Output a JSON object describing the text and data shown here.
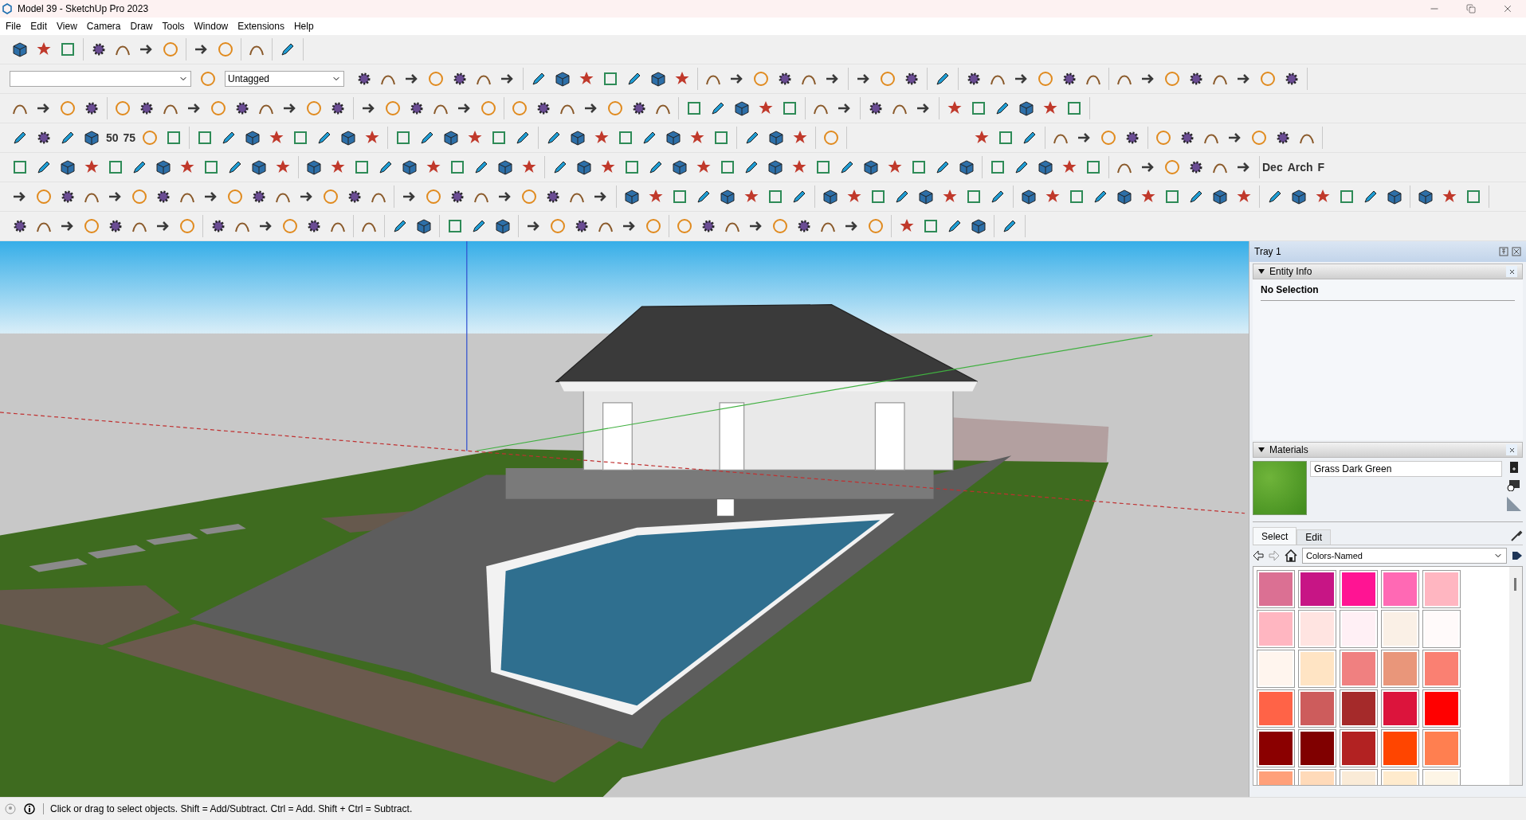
{
  "window": {
    "title": "Model 39 - SketchUp Pro 2023"
  },
  "menu": [
    "File",
    "Edit",
    "View",
    "Camera",
    "Draw",
    "Tools",
    "Window",
    "Extensions",
    "Help"
  ],
  "toolbar": {
    "tag_dropdown": "Untagged",
    "number_buttons": [
      "50",
      "75"
    ],
    "unit_buttons": [
      "Dec",
      "Arch",
      "F"
    ]
  },
  "tray": {
    "title": "Tray 1",
    "entity_info": {
      "title": "Entity Info",
      "expanded": true,
      "selection": "No Selection"
    },
    "materials": {
      "title": "Materials",
      "expanded": true,
      "material_name": "Grass Dark Green",
      "tabs": [
        {
          "label": "Select",
          "selected": true
        },
        {
          "label": "Edit",
          "selected": false
        }
      ],
      "collection": "Colors-Named",
      "swatches": [
        {
          "color": "#db7093"
        },
        {
          "color": "#c71585"
        },
        {
          "color": "#ff1493"
        },
        {
          "color": "#ff69b4"
        },
        {
          "color": "#ffb6c1"
        },
        {
          "color": "#ffb6c1"
        },
        {
          "color": "#ffe4e1"
        },
        {
          "color": "#fff0f5"
        },
        {
          "color": "#faf0e6"
        },
        {
          "color": "#fffafa"
        },
        {
          "color": "#fff5ee"
        },
        {
          "color": "#ffe4c4"
        },
        {
          "color": "#f08080"
        },
        {
          "color": "#e9967a"
        },
        {
          "color": "#fa8072"
        },
        {
          "color": "#ff6347"
        },
        {
          "color": "#cd5c5c"
        },
        {
          "color": "#a52a2a"
        },
        {
          "color": "#dc143c"
        },
        {
          "color": "#ff0000"
        },
        {
          "color": "#8b0000"
        },
        {
          "color": "#800000"
        },
        {
          "color": "#b22222"
        },
        {
          "color": "#ff4500"
        },
        {
          "color": "#ff7f50"
        },
        {
          "color": "#ffa07a"
        },
        {
          "color": "#ffdab9"
        },
        {
          "color": "#faebd7"
        },
        {
          "color": "#ffebcd"
        },
        {
          "color": "#fdf5e6"
        }
      ]
    }
  },
  "status_bar": {
    "message": "Click or drag to select objects. Shift = Add/Subtract. Ctrl = Add. Shift + Ctrl = Subtract."
  }
}
